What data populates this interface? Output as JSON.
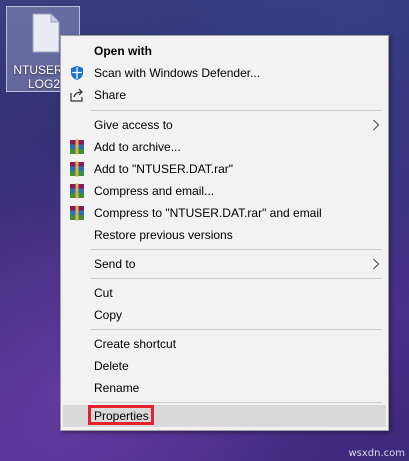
{
  "desktop": {
    "file_label_line1": "NTUSER.D",
    "file_label_line2": "LOG2"
  },
  "context_menu": {
    "items": [
      {
        "label": "Open with",
        "icon": "none"
      },
      {
        "label": "Scan with Windows Defender...",
        "icon": "defender-shield-icon"
      },
      {
        "label": "Share",
        "icon": "share-icon"
      },
      {
        "label": "Give access to",
        "icon": "none"
      },
      {
        "label": "Add to archive...",
        "icon": "winrar-icon"
      },
      {
        "label": "Add to \"NTUSER.DAT.rar\"",
        "icon": "winrar-icon"
      },
      {
        "label": "Compress and email...",
        "icon": "winrar-icon"
      },
      {
        "label": "Compress to \"NTUSER.DAT.rar\" and email",
        "icon": "winrar-icon"
      },
      {
        "label": "Restore previous versions",
        "icon": "none"
      },
      {
        "label": "Send to",
        "icon": "none"
      },
      {
        "label": "Cut",
        "icon": "none"
      },
      {
        "label": "Copy",
        "icon": "none"
      },
      {
        "label": "Create shortcut",
        "icon": "none"
      },
      {
        "label": "Delete",
        "icon": "none"
      },
      {
        "label": "Rename",
        "icon": "none"
      },
      {
        "label": "Properties",
        "icon": "none"
      }
    ],
    "highlighted_item": "Properties",
    "highlight_outline_color": "#e8202e"
  },
  "watermark": "wsxdn.com"
}
